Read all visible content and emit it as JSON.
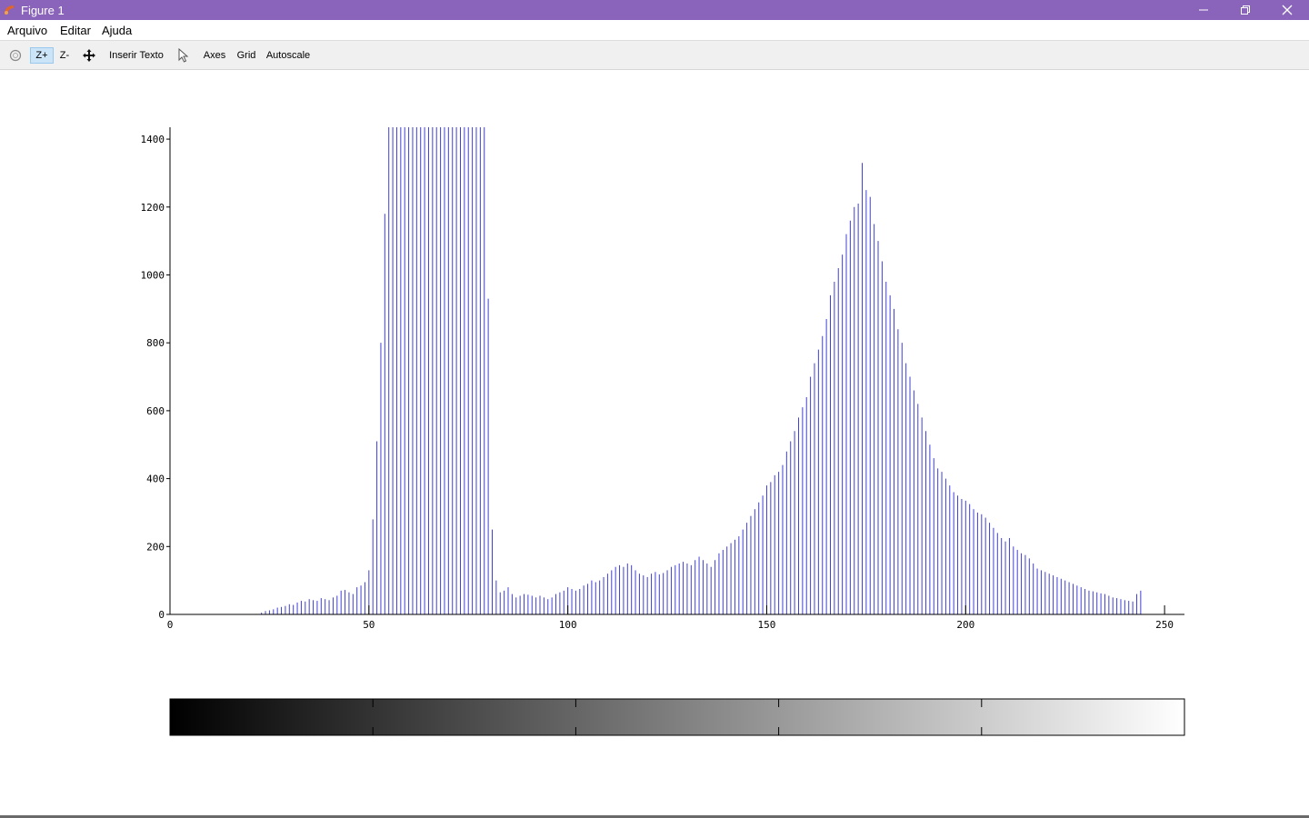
{
  "window": {
    "title": "Figure 1",
    "accent": "#8a64ba"
  },
  "menu": {
    "items": [
      "Arquivo",
      "Editar",
      "Ajuda"
    ]
  },
  "toolbar": {
    "zoom_in_label": "Z+",
    "zoom_out_label": "Z-",
    "insert_text_label": "Inserir Texto",
    "axes_label": "Axes",
    "grid_label": "Grid",
    "autoscale_label": "Autoscale"
  },
  "chart_data": {
    "type": "bar",
    "title": "",
    "xlabel": "",
    "ylabel": "",
    "xlim": [
      0,
      255
    ],
    "ylim": [
      0,
      1435
    ],
    "x_ticks": [
      0,
      50,
      100,
      150,
      200,
      250
    ],
    "y_ticks": [
      0,
      200,
      400,
      600,
      800,
      1000,
      1200,
      1400
    ],
    "bar_color": "#3f3fd6",
    "colorbar": {
      "type": "grayscale",
      "from": "#000000",
      "to": "#ffffff"
    },
    "bins": [
      0,
      1,
      2,
      3,
      4,
      5,
      6,
      7,
      8,
      9,
      10,
      11,
      12,
      13,
      14,
      15,
      16,
      17,
      18,
      19,
      20,
      21,
      22,
      23,
      24,
      25,
      26,
      27,
      28,
      29,
      30,
      31,
      32,
      33,
      34,
      35,
      36,
      37,
      38,
      39,
      40,
      41,
      42,
      43,
      44,
      45,
      46,
      47,
      48,
      49,
      50,
      51,
      52,
      53,
      54,
      55,
      56,
      57,
      58,
      59,
      60,
      61,
      62,
      63,
      64,
      65,
      66,
      67,
      68,
      69,
      70,
      71,
      72,
      73,
      74,
      75,
      76,
      77,
      78,
      79,
      80,
      81,
      82,
      83,
      84,
      85,
      86,
      87,
      88,
      89,
      90,
      91,
      92,
      93,
      94,
      95,
      96,
      97,
      98,
      99,
      100,
      101,
      102,
      103,
      104,
      105,
      106,
      107,
      108,
      109,
      110,
      111,
      112,
      113,
      114,
      115,
      116,
      117,
      118,
      119,
      120,
      121,
      122,
      123,
      124,
      125,
      126,
      127,
      128,
      129,
      130,
      131,
      132,
      133,
      134,
      135,
      136,
      137,
      138,
      139,
      140,
      141,
      142,
      143,
      144,
      145,
      146,
      147,
      148,
      149,
      150,
      151,
      152,
      153,
      154,
      155,
      156,
      157,
      158,
      159,
      160,
      161,
      162,
      163,
      164,
      165,
      166,
      167,
      168,
      169,
      170,
      171,
      172,
      173,
      174,
      175,
      176,
      177,
      178,
      179,
      180,
      181,
      182,
      183,
      184,
      185,
      186,
      187,
      188,
      189,
      190,
      191,
      192,
      193,
      194,
      195,
      196,
      197,
      198,
      199,
      200,
      201,
      202,
      203,
      204,
      205,
      206,
      207,
      208,
      209,
      210,
      211,
      212,
      213,
      214,
      215,
      216,
      217,
      218,
      219,
      220,
      221,
      222,
      223,
      224,
      225,
      226,
      227,
      228,
      229,
      230,
      231,
      232,
      233,
      234,
      235,
      236,
      237,
      238,
      239,
      240,
      241,
      242,
      243,
      244,
      245,
      246,
      247,
      248,
      249,
      250,
      251,
      252,
      253,
      254,
      255
    ],
    "values": [
      0,
      0,
      0,
      0,
      0,
      0,
      0,
      0,
      0,
      0,
      0,
      0,
      0,
      0,
      0,
      0,
      0,
      0,
      0,
      0,
      0,
      0,
      0,
      5,
      10,
      12,
      15,
      20,
      22,
      25,
      30,
      28,
      35,
      40,
      38,
      45,
      42,
      40,
      48,
      45,
      42,
      50,
      55,
      70,
      72,
      65,
      60,
      80,
      85,
      95,
      130,
      280,
      510,
      800,
      1180,
      1435,
      1435,
      1435,
      1435,
      1435,
      1435,
      1435,
      1435,
      1435,
      1435,
      1435,
      1435,
      1435,
      1435,
      1435,
      1435,
      1435,
      1435,
      1435,
      1435,
      1435,
      1435,
      1435,
      1435,
      1435,
      930,
      250,
      100,
      65,
      70,
      80,
      60,
      50,
      55,
      60,
      58,
      55,
      50,
      55,
      50,
      45,
      50,
      60,
      65,
      70,
      80,
      75,
      70,
      75,
      85,
      90,
      100,
      95,
      100,
      110,
      120,
      130,
      140,
      145,
      140,
      150,
      145,
      130,
      120,
      115,
      110,
      120,
      125,
      118,
      122,
      130,
      140,
      145,
      150,
      155,
      150,
      145,
      160,
      170,
      160,
      150,
      140,
      160,
      180,
      190,
      200,
      210,
      220,
      230,
      250,
      270,
      290,
      310,
      330,
      350,
      380,
      390,
      410,
      420,
      440,
      480,
      510,
      540,
      580,
      610,
      640,
      700,
      740,
      780,
      820,
      870,
      940,
      980,
      1020,
      1060,
      1120,
      1160,
      1200,
      1210,
      1330,
      1250,
      1230,
      1150,
      1100,
      1040,
      980,
      940,
      900,
      840,
      800,
      740,
      700,
      660,
      620,
      580,
      540,
      500,
      460,
      430,
      420,
      400,
      380,
      360,
      350,
      340,
      335,
      325,
      310,
      300,
      295,
      285,
      270,
      255,
      240,
      225,
      215,
      225,
      200,
      190,
      180,
      175,
      165,
      150,
      135,
      130,
      125,
      120,
      115,
      110,
      105,
      100,
      95,
      90,
      85,
      80,
      75,
      70,
      68,
      65,
      62,
      60,
      55,
      50,
      48,
      45,
      42,
      40,
      38,
      60,
      70
    ]
  }
}
